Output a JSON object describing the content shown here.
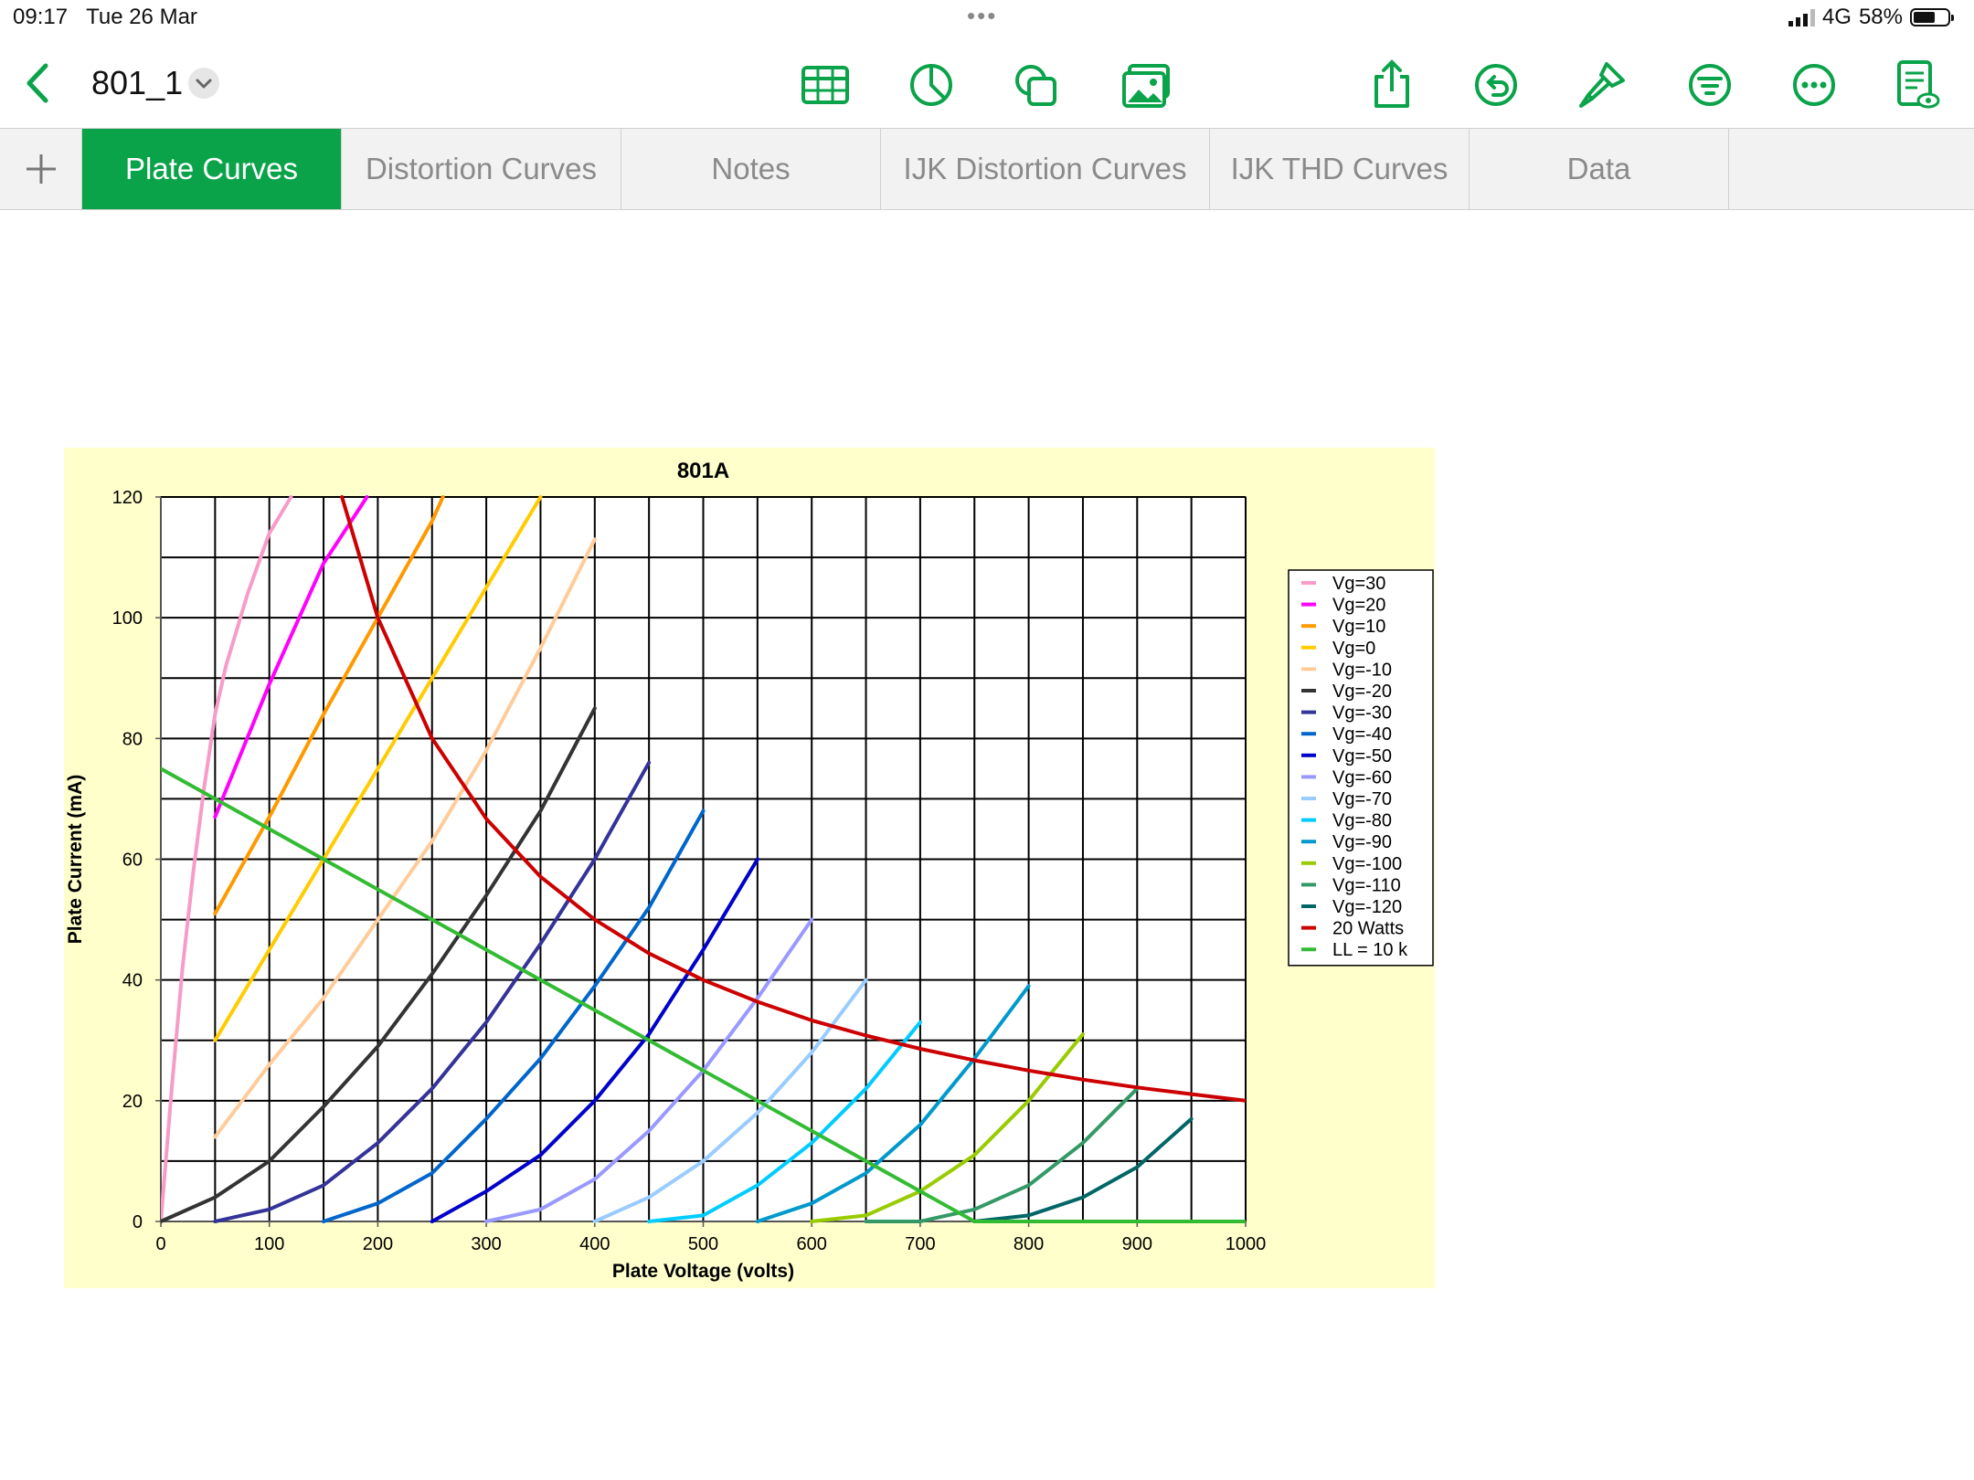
{
  "status": {
    "time": "09:17",
    "date": "Tue 26 Mar",
    "network": "4G",
    "battery": "58%",
    "battery_level": 0.58
  },
  "toolbar": {
    "title": "801_1",
    "icons": [
      "back-chevron-icon",
      "title-dropdown-icon",
      "table-icon",
      "chart-icon",
      "shapes-icon",
      "media-icon",
      "share-icon",
      "undo-icon",
      "format-brush-icon",
      "organize-icon",
      "more-icon",
      "view-options-icon"
    ],
    "accent": "#0aa34a"
  },
  "tabs": [
    {
      "label": "Plate Curves",
      "active": true
    },
    {
      "label": "Distortion Curves",
      "active": false
    },
    {
      "label": "Notes",
      "active": false
    },
    {
      "label": "IJK Distortion Curves",
      "active": false
    },
    {
      "label": "IJK THD Curves",
      "active": false
    },
    {
      "label": "Data",
      "active": false
    }
  ],
  "chart_data": {
    "type": "line",
    "title": "801A",
    "xlabel": "Plate Voltage (volts)",
    "ylabel": "Plate Current (mA)",
    "xlim": [
      0,
      1000
    ],
    "ylim": [
      0,
      120
    ],
    "xticks": [
      0,
      100,
      200,
      300,
      400,
      500,
      600,
      700,
      800,
      900,
      1000
    ],
    "yticks": [
      0,
      20,
      40,
      60,
      80,
      100,
      120
    ],
    "grid": true,
    "background": "#ffffcc",
    "legend_position": "right",
    "series": [
      {
        "name": "Vg=30",
        "color": "#f79bc8",
        "x": [
          0,
          10,
          20,
          30,
          40,
          50,
          60,
          80,
          100,
          120
        ],
        "y": [
          0,
          22,
          42,
          58,
          72,
          84,
          92,
          104,
          114,
          120
        ]
      },
      {
        "name": "Vg=20",
        "color": "#ff00ff",
        "x": [
          50,
          100,
          150,
          190
        ],
        "y": [
          67,
          89,
          109,
          120
        ]
      },
      {
        "name": "Vg=10",
        "color": "#ff9900",
        "x": [
          50,
          100,
          150,
          200,
          250,
          260
        ],
        "y": [
          51,
          67,
          84,
          100,
          116,
          120
        ]
      },
      {
        "name": "Vg=0",
        "color": "#ffcc00",
        "x": [
          50,
          100,
          150,
          200,
          250,
          300,
          350
        ],
        "y": [
          30,
          45,
          60,
          75,
          90,
          105,
          120
        ]
      },
      {
        "name": "Vg=-10",
        "color": "#ffcc99",
        "x": [
          50,
          100,
          150,
          200,
          250,
          300,
          350,
          400
        ],
        "y": [
          14,
          26,
          37,
          50,
          63,
          78,
          95,
          113
        ]
      },
      {
        "name": "Vg=-20",
        "color": "#333333",
        "x": [
          0,
          50,
          100,
          150,
          200,
          250,
          300,
          350,
          400
        ],
        "y": [
          0,
          4,
          10,
          19,
          29,
          41,
          54,
          68,
          85
        ]
      },
      {
        "name": "Vg=-30",
        "color": "#333399",
        "x": [
          50,
          100,
          150,
          200,
          250,
          300,
          350,
          400,
          450
        ],
        "y": [
          0,
          2,
          6,
          13,
          22,
          33,
          46,
          60,
          76
        ]
      },
      {
        "name": "Vg=-40",
        "color": "#0066cc",
        "x": [
          150,
          200,
          250,
          300,
          350,
          400,
          450,
          500
        ],
        "y": [
          0,
          3,
          8,
          17,
          27,
          39,
          52,
          68
        ]
      },
      {
        "name": "Vg=-50",
        "color": "#0000cc",
        "x": [
          250,
          300,
          350,
          400,
          450,
          500,
          550
        ],
        "y": [
          0,
          5,
          11,
          20,
          31,
          45,
          60
        ]
      },
      {
        "name": "Vg=-60",
        "color": "#9999ff",
        "x": [
          300,
          350,
          400,
          450,
          500,
          550,
          600
        ],
        "y": [
          0,
          2,
          7,
          15,
          25,
          37,
          50
        ]
      },
      {
        "name": "Vg=-70",
        "color": "#99ccff",
        "x": [
          400,
          450,
          500,
          550,
          600,
          650
        ],
        "y": [
          0,
          4,
          10,
          18,
          28,
          40
        ]
      },
      {
        "name": "Vg=-80",
        "color": "#00ccff",
        "x": [
          450,
          500,
          550,
          600,
          650,
          700
        ],
        "y": [
          0,
          1,
          6,
          13,
          22,
          33
        ]
      },
      {
        "name": "Vg=-90",
        "color": "#0099cc",
        "x": [
          550,
          600,
          650,
          700,
          750,
          800
        ],
        "y": [
          0,
          3,
          8,
          16,
          27,
          39
        ]
      },
      {
        "name": "Vg=-100",
        "color": "#99cc00",
        "x": [
          600,
          650,
          700,
          750,
          800,
          850
        ],
        "y": [
          0,
          1,
          5,
          11,
          20,
          31
        ]
      },
      {
        "name": "Vg=-110",
        "color": "#339966",
        "x": [
          650,
          700,
          750,
          800,
          850,
          900
        ],
        "y": [
          0,
          0,
          2,
          6,
          13,
          22
        ]
      },
      {
        "name": "Vg=-120",
        "color": "#006666",
        "x": [
          750,
          800,
          850,
          900,
          950
        ],
        "y": [
          0,
          1,
          4,
          9,
          17
        ]
      },
      {
        "name": "20 Watts",
        "color": "#cc0000",
        "x": [
          167,
          200,
          250,
          300,
          350,
          400,
          450,
          500,
          550,
          600,
          650,
          700,
          750,
          800,
          850,
          900,
          950,
          1000
        ],
        "y": [
          120,
          100,
          80,
          66.7,
          57.1,
          50,
          44.4,
          40,
          36.4,
          33.3,
          30.8,
          28.6,
          26.7,
          25,
          23.5,
          22.2,
          21.1,
          20
        ]
      },
      {
        "name": "LL = 10 k",
        "color": "#33bb33",
        "x": [
          0,
          750,
          1000
        ],
        "y": [
          75,
          0,
          0
        ]
      }
    ]
  }
}
